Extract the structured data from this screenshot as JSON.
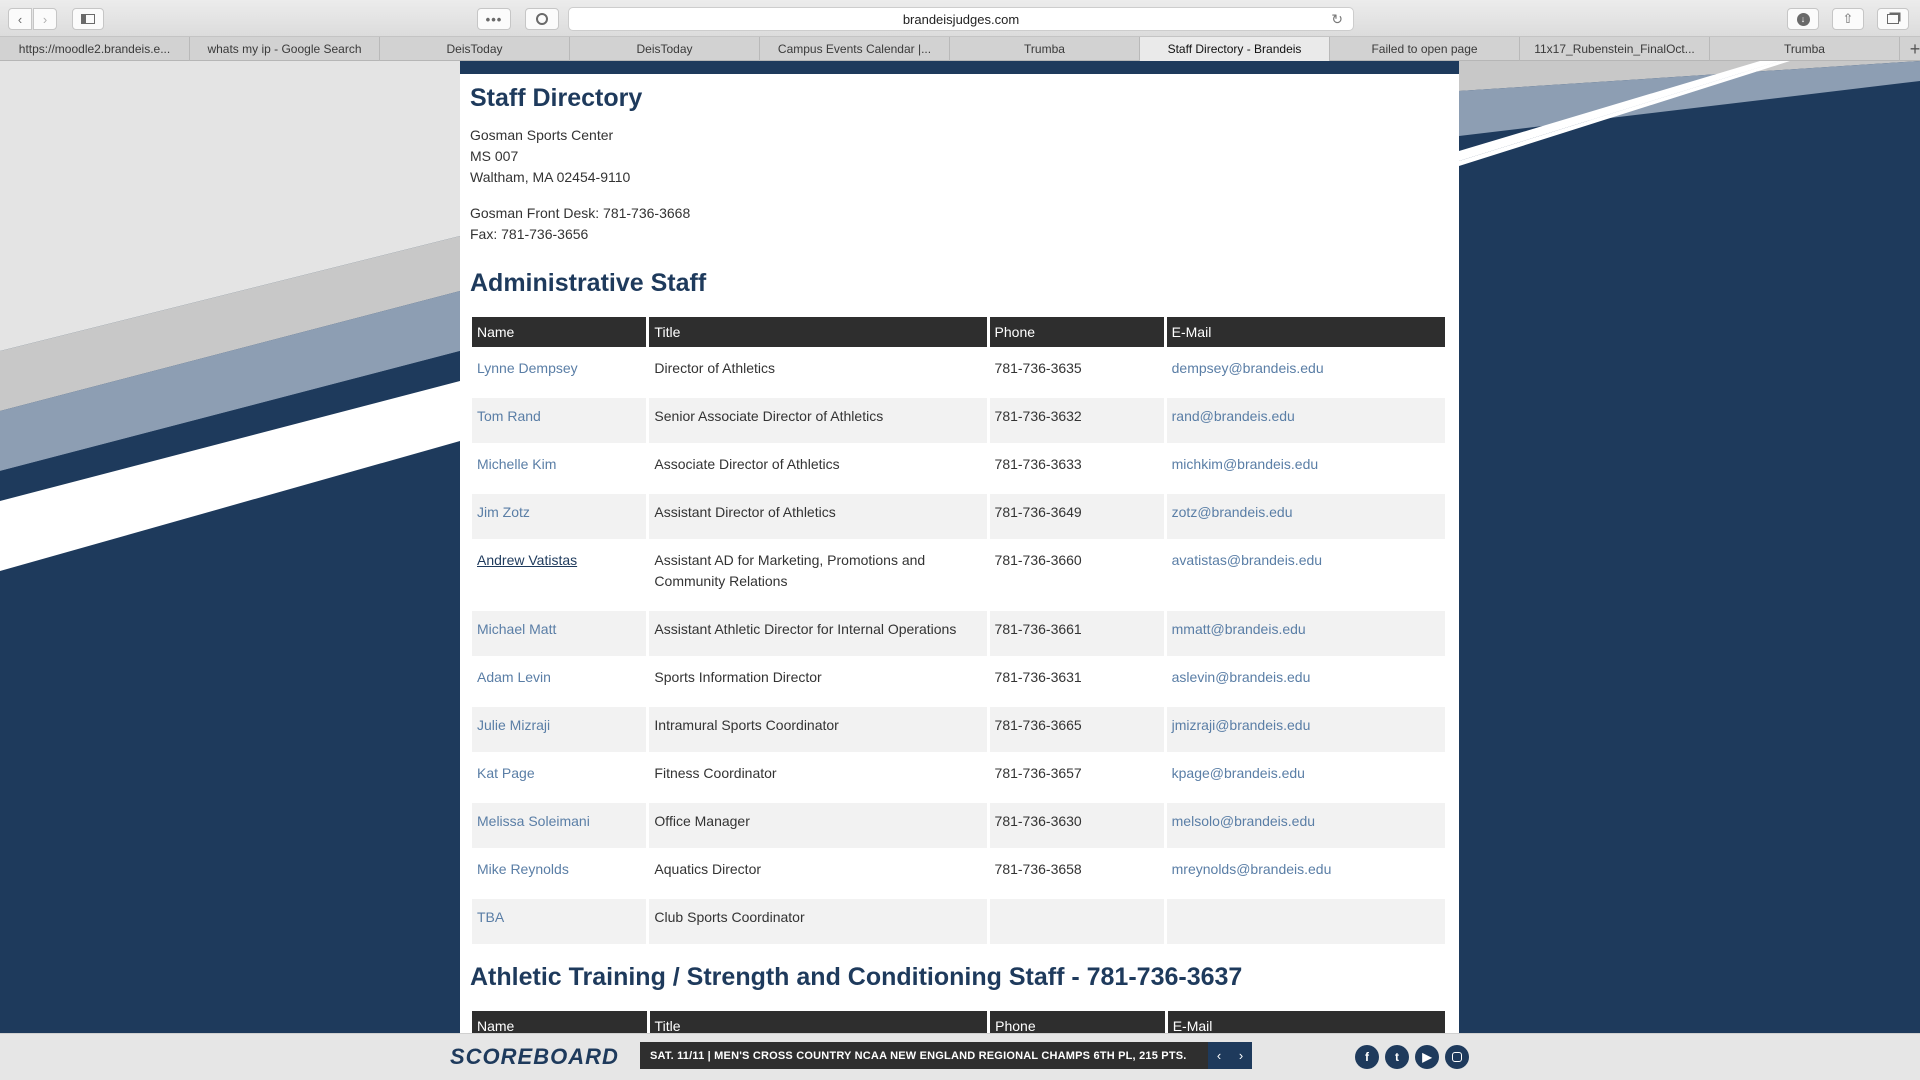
{
  "browser": {
    "url": "brandeisjudges.com",
    "tabs": [
      {
        "label": "https://moodle2.brandeis.e...",
        "active": false
      },
      {
        "label": "whats my ip - Google Search",
        "active": false
      },
      {
        "label": "DeisToday",
        "active": false
      },
      {
        "label": "DeisToday",
        "active": false
      },
      {
        "label": "Campus Events Calendar |...",
        "active": false
      },
      {
        "label": "Trumba",
        "active": false
      },
      {
        "label": "Staff Directory - Brandeis",
        "active": true
      },
      {
        "label": "Failed to open page",
        "active": false
      },
      {
        "label": "11x17_Rubenstein_FinalOct...",
        "active": false
      },
      {
        "label": "Trumba",
        "active": false
      }
    ],
    "icons": {
      "back": "chevron-left-icon",
      "forward": "chevron-right-icon",
      "sidebar": "sidebar-icon",
      "more": "ellipsis-icon",
      "privacy": "privacy-icon",
      "reload": "reload-icon",
      "download": "download-icon",
      "share": "share-icon",
      "tabs": "tabs-overview-icon",
      "new_tab": "plus-icon"
    }
  },
  "page": {
    "title": "Staff Directory",
    "address_lines": [
      "Gosman Sports Center",
      "MS 007",
      "Waltham, MA 02454-9110"
    ],
    "contact_lines": [
      "Gosman Front Desk: 781-736-3668",
      "Fax: 781-736-3656"
    ],
    "columns": [
      "Name",
      "Title",
      "Phone",
      "E-Mail"
    ],
    "admin": {
      "heading": "Administrative Staff",
      "rows": [
        {
          "name": "Lynne Dempsey",
          "title": "Director of Athletics",
          "phone": "781-736-3635",
          "email": "dempsey@brandeis.edu"
        },
        {
          "name": "Tom Rand",
          "title": "Senior Associate Director of Athletics",
          "phone": "781-736-3632",
          "email": "rand@brandeis.edu"
        },
        {
          "name": "Michelle Kim",
          "title": "Associate Director of Athletics",
          "phone": "781-736-3633",
          "email": "michkim@brandeis.edu"
        },
        {
          "name": "Jim Zotz",
          "title": "Assistant Director of Athletics",
          "phone": "781-736-3649",
          "email": "zotz@brandeis.edu"
        },
        {
          "name": "Andrew Vatistas",
          "title": "Assistant AD for Marketing, Promotions and Community Relations",
          "phone": "781-736-3660",
          "email": "avatistas@brandeis.edu"
        },
        {
          "name": "Michael Matt",
          "title": "Assistant Athletic Director for Internal Operations",
          "phone": "781-736-3661",
          "email": "mmatt@brandeis.edu"
        },
        {
          "name": "Adam Levin",
          "title": "Sports Information Director",
          "phone": "781-736-3631",
          "email": "aslevin@brandeis.edu"
        },
        {
          "name": "Julie Mizraji",
          "title": "Intramural Sports Coordinator",
          "phone": "781-736-3665",
          "email": "jmizraji@brandeis.edu"
        },
        {
          "name": "Kat Page",
          "title": "Fitness Coordinator",
          "phone": "781-736-3657",
          "email": "kpage@brandeis.edu"
        },
        {
          "name": "Melissa Soleimani",
          "title": "Office Manager",
          "phone": "781-736-3630",
          "email": "melsolo@brandeis.edu"
        },
        {
          "name": "Mike Reynolds",
          "title": "Aquatics Director",
          "phone": "781-736-3658",
          "email": "mreynolds@brandeis.edu"
        },
        {
          "name": "TBA",
          "title": "Club Sports Coordinator",
          "phone": "",
          "email": ""
        }
      ]
    },
    "training": {
      "heading": "Athletic Training / Strength and Conditioning Staff - 781-736-3637"
    }
  },
  "scoreboard": {
    "logo": "SCOREBOARD",
    "ticker": "SAT. 11/11 | MEN'S CROSS COUNTRY NCAA NEW ENGLAND REGIONAL CHAMPS 6TH PL, 215 PTS.",
    "social": [
      "facebook-icon",
      "twitter-icon",
      "youtube-icon",
      "instagram-icon"
    ]
  },
  "colors": {
    "navy": "#1e3a5c",
    "link": "#5a7ea6",
    "header_bg": "#2e2e2e"
  }
}
